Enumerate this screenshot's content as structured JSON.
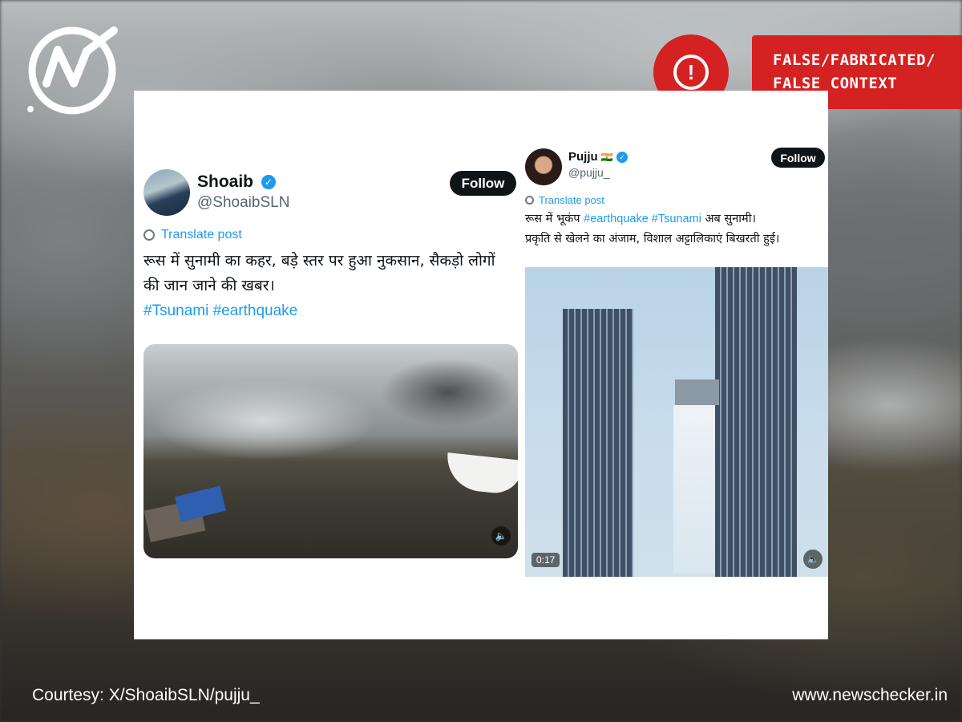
{
  "verdict": {
    "line1": "FALSE/FABRICATED/",
    "line2": "FALSE CONTEXT",
    "icon": "alert-icon",
    "color": "#d42121"
  },
  "logo": {
    "icon": "newschecker-logo-icon"
  },
  "posts": [
    {
      "name": "Shoaib",
      "handle": "@ShoaibSLN",
      "follow_label": "Follow",
      "translate_label": "Translate post",
      "text_line1": "रूस में सुनामी का कहर, बड़े स्तर पर हुआ नुकसान, सैकड़ो लोगों",
      "text_line2": "की जान जाने की खबर।",
      "hashtags": "#Tsunami #earthquake"
    },
    {
      "name": "Pujju",
      "flag": "🇮🇳",
      "handle": "@pujju_",
      "follow_label": "Follow",
      "translate_label": "Translate post",
      "text_line1_a": "रूस में भूकंप ",
      "text_line1_tags": "#earthquake #Tsunami",
      "text_line1_b": " अब सुनामी।",
      "text_line2": "प्रकृति से खेलने का अंजाम, विशाल अट्टालिकाएं बिखरती हुई।",
      "video_duration": "0:17"
    }
  ],
  "footer": {
    "courtesy": "Courtesy: X/ShoaibSLN/pujju_",
    "website": "www.newschecker.in"
  },
  "colors": {
    "twitter_blue": "#1d9bf0",
    "verdict_red": "#d42121"
  }
}
